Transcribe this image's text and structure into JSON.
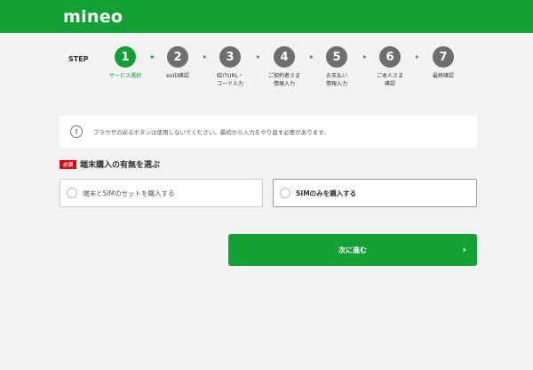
{
  "header": {
    "logo": "mineo",
    "brand_color": "#13a034"
  },
  "stepper": {
    "label": "STEP",
    "steps": [
      {
        "num": "1",
        "label": "サービス選択",
        "active": true
      },
      {
        "num": "2",
        "label": "eoID確認",
        "active": false
      },
      {
        "num": "3",
        "label": "紹介URL・\nコード入力",
        "active": false
      },
      {
        "num": "4",
        "label": "ご契約者さま\n情報入力",
        "active": false
      },
      {
        "num": "5",
        "label": "お支払い\n情報入力",
        "active": false
      },
      {
        "num": "6",
        "label": "ご本人さま\n確認",
        "active": false
      },
      {
        "num": "7",
        "label": "最終確認",
        "active": false
      }
    ]
  },
  "notice": {
    "icon": "exclamation-circle-icon",
    "text": "ブラウザの戻るボタンは使用しないでください。最初から入力をやり直す必要があります。"
  },
  "section": {
    "required_badge": "必須",
    "title": "端末購入の有無を選ぶ",
    "options": [
      {
        "label": "端末とSIMのセットを購入する",
        "selected": false
      },
      {
        "label": "SIMのみを購入する",
        "selected": false
      }
    ]
  },
  "next_button": {
    "label": "次に進む",
    "icon": "chevron-right-icon"
  }
}
